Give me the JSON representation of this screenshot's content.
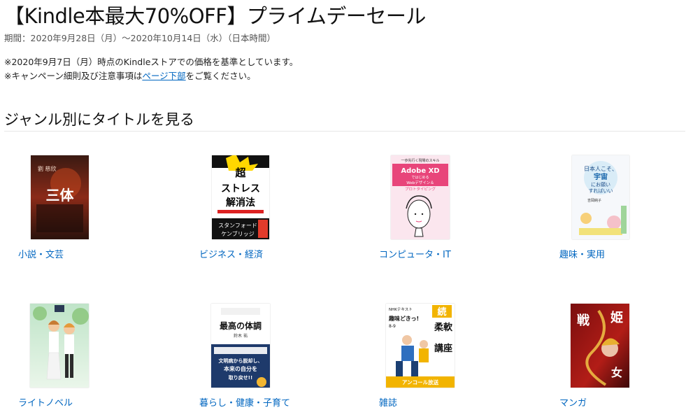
{
  "header": {
    "title": "【Kindle本最大70%OFF】プライムデーセール",
    "period": "期間：2020年9月28日（月）〜2020年10月14日（水）（日本時間）",
    "note1": "※2020年9月7日（月）時点のKindleストアでの価格を基準としています。",
    "note2_prefix": "※キャンペーン細則及び注意事項は",
    "note2_link": "ページ下部",
    "note2_suffix": "をご覧ください。"
  },
  "section": {
    "title": "ジャンル別にタイトルを見る"
  },
  "categories": [
    {
      "label": "小説・文芸",
      "cover_text": [
        "劉 慈欣",
        "三体"
      ]
    },
    {
      "label": "ビジネス・経済",
      "cover_text": [
        "超",
        "ストレス",
        "解消法",
        "スタンフォード",
        "ケンブリッジ"
      ]
    },
    {
      "label": "コンピュータ・IT",
      "cover_text": [
        "一歩先行く現場のスキル",
        "Adobe XD",
        "ではじめる",
        "Webデザイン＆",
        "プロトタイピング"
      ]
    },
    {
      "label": "趣味・実用",
      "cover_text": [
        "日本人こそ、",
        "宇宙",
        "にお願い",
        "すればいい",
        "吉岡純子"
      ]
    },
    {
      "label": "ライトノベル",
      "cover_text": []
    },
    {
      "label": "暮らし・健康・子育て",
      "cover_text": [
        "最高の体調",
        "鈴木 祐",
        "文明病から脱却し、",
        "本来の自分を",
        "取り戻せ!!"
      ]
    },
    {
      "label": "雑誌",
      "cover_text": [
        "NHKテキスト",
        "趣味どきっ!",
        "8-9",
        "続",
        "柔軟",
        "講座",
        "アンコール放送"
      ]
    },
    {
      "label": "マンガ",
      "cover_text": [
        "戦",
        "姫",
        "女"
      ]
    }
  ],
  "colors": {
    "link": "#0066c0",
    "divider": "#e7e7e7"
  }
}
